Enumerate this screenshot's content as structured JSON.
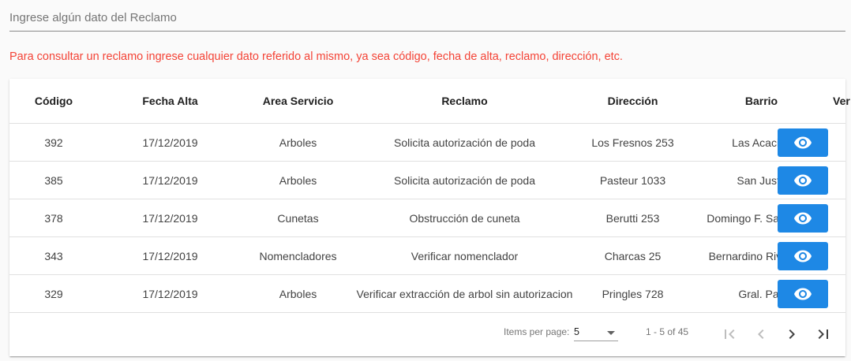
{
  "search": {
    "placeholder": "Ingrese algún dato del Reclamo"
  },
  "hint": "Para consultar un reclamo ingrese cualquier dato referido al mismo, ya sea código, fecha de alta, reclamo, dirección, etc.",
  "table": {
    "headers": [
      "Código",
      "Fecha Alta",
      "Area Servicio",
      "Reclamo",
      "Dirección",
      "Barrio",
      "Ver"
    ],
    "rows": [
      [
        "392",
        "17/12/2019",
        "Arboles",
        "Solicita autorización de poda",
        "Los Fresnos 253",
        "Las Acacias"
      ],
      [
        "385",
        "17/12/2019",
        "Arboles",
        "Solicita autorización de poda",
        "Pasteur 1033",
        "San Justo"
      ],
      [
        "378",
        "17/12/2019",
        "Cunetas",
        "Obstrucción de cuneta",
        "Berutti 253",
        "Domingo F. Sarmiento"
      ],
      [
        "343",
        "17/12/2019",
        "Nomencladores",
        "Verificar nomenclador",
        "Charcas 25",
        "Bernardino Rivadavia"
      ],
      [
        "329",
        "17/12/2019",
        "Arboles",
        "Verificar extracción de arbol sin autorizacion",
        "Pringles 728",
        "Gral. Paz"
      ]
    ]
  },
  "paginator": {
    "items_per_page_label": "Items per page:",
    "page_size": "5",
    "range_label": "1 - 5 of 45"
  },
  "colors": {
    "accent": "#1e88e5",
    "hint": "#f44336"
  }
}
